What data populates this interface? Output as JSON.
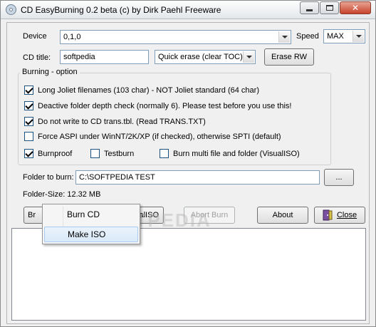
{
  "window": {
    "title": "CD EasyBurning 0.2 beta (c) by Dirk Paehl Freeware"
  },
  "device": {
    "label": "Device",
    "value": "0,1,0",
    "speed_label": "Speed",
    "speed_value": "MAX"
  },
  "cd_title": {
    "label": "CD title:",
    "value": "softpedia",
    "erase_mode": "Quick erase (clear TOC)",
    "erase_button": "Erase RW"
  },
  "burning": {
    "group_label": "Burning - option",
    "options": [
      {
        "label": "Long Joliet filenames (103 char) - NOT Joliet standard (64 char)",
        "checked": true
      },
      {
        "label": "Deactive folder depth check (normally 6). Please test before you use this!",
        "checked": true
      },
      {
        "label": "Do not write to CD trans.tbl. (Read TRANS.TXT)",
        "checked": true
      },
      {
        "label": "Force ASPI under WinNT/2K/XP (if checked), otherwise SPTI (default)",
        "checked": false
      }
    ],
    "burnproof": {
      "label": "Burnproof",
      "checked": true
    },
    "testburn": {
      "label": "Testburn",
      "checked": false
    },
    "multi": {
      "label": "Burn multi file and folder (VisualISO)",
      "checked": false
    }
  },
  "folder": {
    "label": "Folder to burn:",
    "value": "C:\\SOFTPEDIA TEST",
    "browse_label": "...",
    "size_text": "Folder-Size: 12.32 MB"
  },
  "actions": {
    "burn_label": "Br",
    "visualiso_label": "isualISO",
    "abort_label": "Abort Burn",
    "about_label": "About",
    "close_label": "Close"
  },
  "popup_menu": {
    "items": [
      "Burn CD",
      "Make ISO"
    ]
  },
  "watermark": "SOFTPEDIA"
}
